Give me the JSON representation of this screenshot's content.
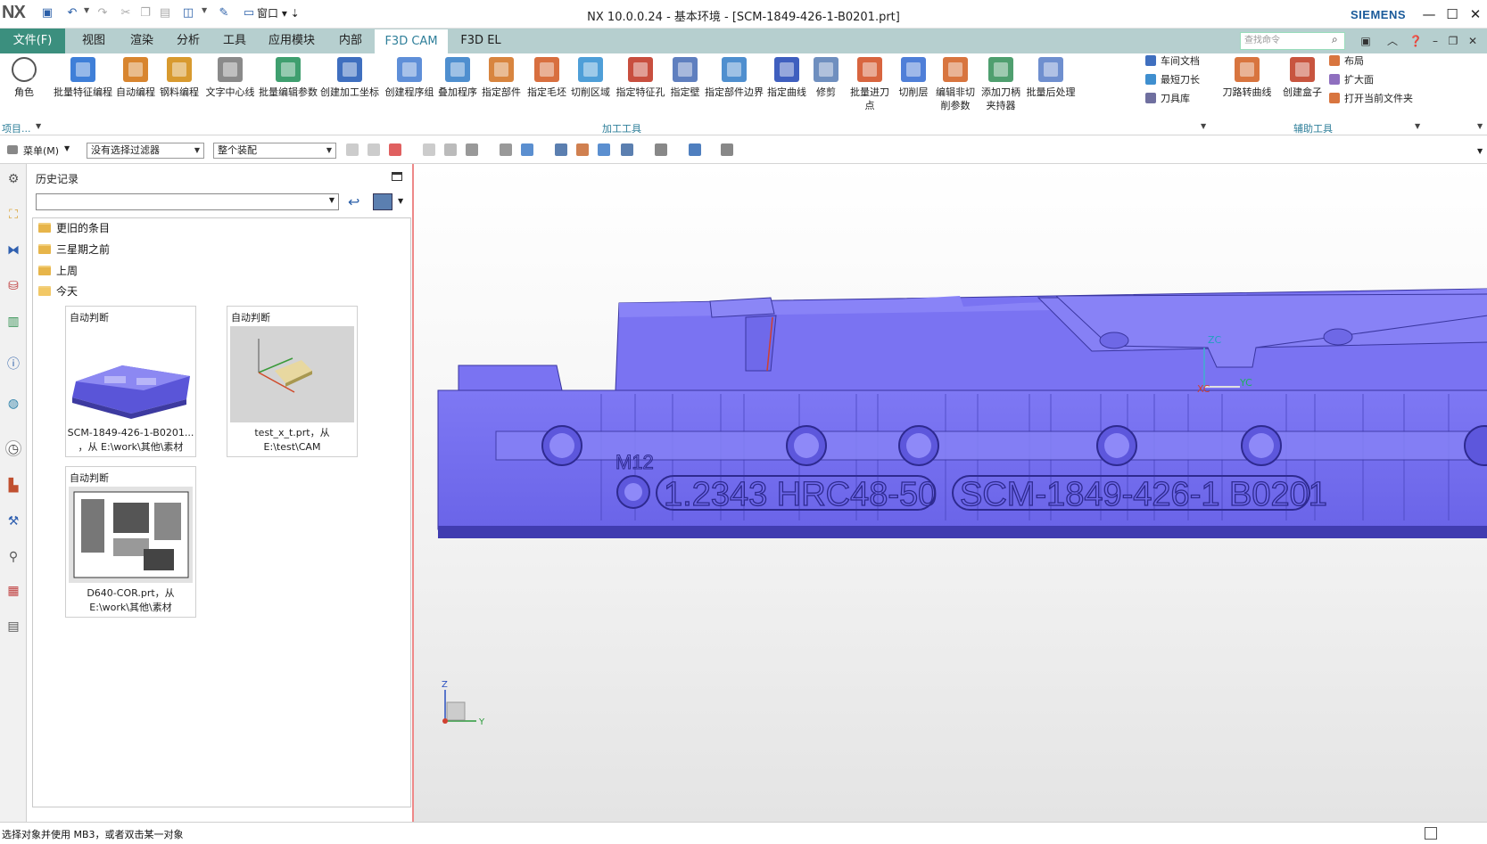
{
  "titlebar": {
    "logo": "NX",
    "window_menu": "窗口",
    "title": "NX 10.0.0.24 - 基本环境 - [SCM-1849-426-1-B0201.prt]",
    "brand": "SIEMENS"
  },
  "tabs": {
    "file": "文件(F)",
    "items": [
      "视图",
      "渲染",
      "分析",
      "工具",
      "应用模块",
      "内部",
      "F3D CAM",
      "F3D EL"
    ],
    "active": "F3D CAM",
    "search_placeholder": "查找命令"
  },
  "ribbon": {
    "role_label": "角色",
    "project_label": "项目...",
    "machining_group": "加工工具",
    "aux_group": "辅助工具",
    "machining_buttons": [
      {
        "label": "批量特征编程",
        "color": "#3f7fd8"
      },
      {
        "label": "自动编程",
        "color": "#d8852f"
      },
      {
        "label": "钢料编程",
        "color": "#d89a2f"
      },
      {
        "label": "文字中心线",
        "color": "#8a8a8a"
      },
      {
        "label": "批量编辑参数",
        "color": "#3f9f6f"
      },
      {
        "label": "创建加工坐标",
        "color": "#3f6fbf"
      },
      {
        "label": "创建程序组",
        "color": "#5f8fd8"
      },
      {
        "label": "叠加程序",
        "color": "#4f8fcf"
      },
      {
        "label": "指定部件",
        "color": "#d8853f"
      },
      {
        "label": "指定毛坯",
        "color": "#d86f3f"
      },
      {
        "label": "切削区域",
        "color": "#4f9fd8"
      },
      {
        "label": "指定特征孔",
        "color": "#c84f3f"
      },
      {
        "label": "指定壁",
        "color": "#5f7fbf"
      },
      {
        "label": "指定部件边界",
        "color": "#4f8fcf"
      },
      {
        "label": "指定曲线",
        "color": "#3f5fbf"
      },
      {
        "label": "修剪",
        "color": "#6f8fbf"
      },
      {
        "label": "批量进刀点",
        "color": "#d8653f"
      },
      {
        "label": "切削层",
        "color": "#4f7fd8"
      },
      {
        "label": "编辑非切削参数",
        "color": "#d8753f"
      },
      {
        "label": "添加刀柄夹持器",
        "color": "#4f9f6f"
      },
      {
        "label": "批量后处理",
        "color": "#6f8fcf"
      }
    ],
    "small_buttons": [
      {
        "label": "车间文档",
        "color": "#3f6fbf"
      },
      {
        "label": "最短刀长",
        "color": "#3f8fcf"
      },
      {
        "label": "刀具库",
        "color": "#6f6f9f"
      }
    ],
    "aux_buttons": [
      {
        "label": "刀路转曲线",
        "color": "#d8753f"
      },
      {
        "label": "创建盒子",
        "color": "#c8553f"
      }
    ],
    "aux_small_buttons": [
      {
        "label": "布局",
        "color": "#d8753f"
      },
      {
        "label": "扩大面",
        "color": "#8f6fbf"
      },
      {
        "label": "打开当前文件夹",
        "color": "#d8753f"
      }
    ]
  },
  "toolbar": {
    "menu_label": "菜单(M)",
    "filter": "没有选择过滤器",
    "assembly": "整个装配"
  },
  "history": {
    "title": "历史记录",
    "folders": [
      "更旧的条目",
      "三星期之前",
      "上周",
      "今天"
    ],
    "cards": [
      {
        "head": "自动判断",
        "name1": "SCM-1849-426-1-B0201...",
        "name2": "，从 E:\\work\\其他\\素材"
      },
      {
        "head": "自动判断",
        "name1": "test_x_t.prt，从",
        "name2": "E:\\test\\CAM"
      },
      {
        "head": "自动判断",
        "name1": "D640-COR.prt，从",
        "name2": "E:\\work\\其他\\素材"
      }
    ]
  },
  "viewport": {
    "engraving_material": "1.2343  HRC48-50",
    "engraving_part": "SCM-1849-426-1  B0201",
    "thread_label": "M12",
    "csys_zc": "ZC",
    "csys_yc": "YC",
    "csys_xc": "XC",
    "triad_z": "Z",
    "triad_y": "Y",
    "model_color": "#7b74f2"
  },
  "status": {
    "text": "选择对象并使用 MB3，或者双击某一对象"
  }
}
